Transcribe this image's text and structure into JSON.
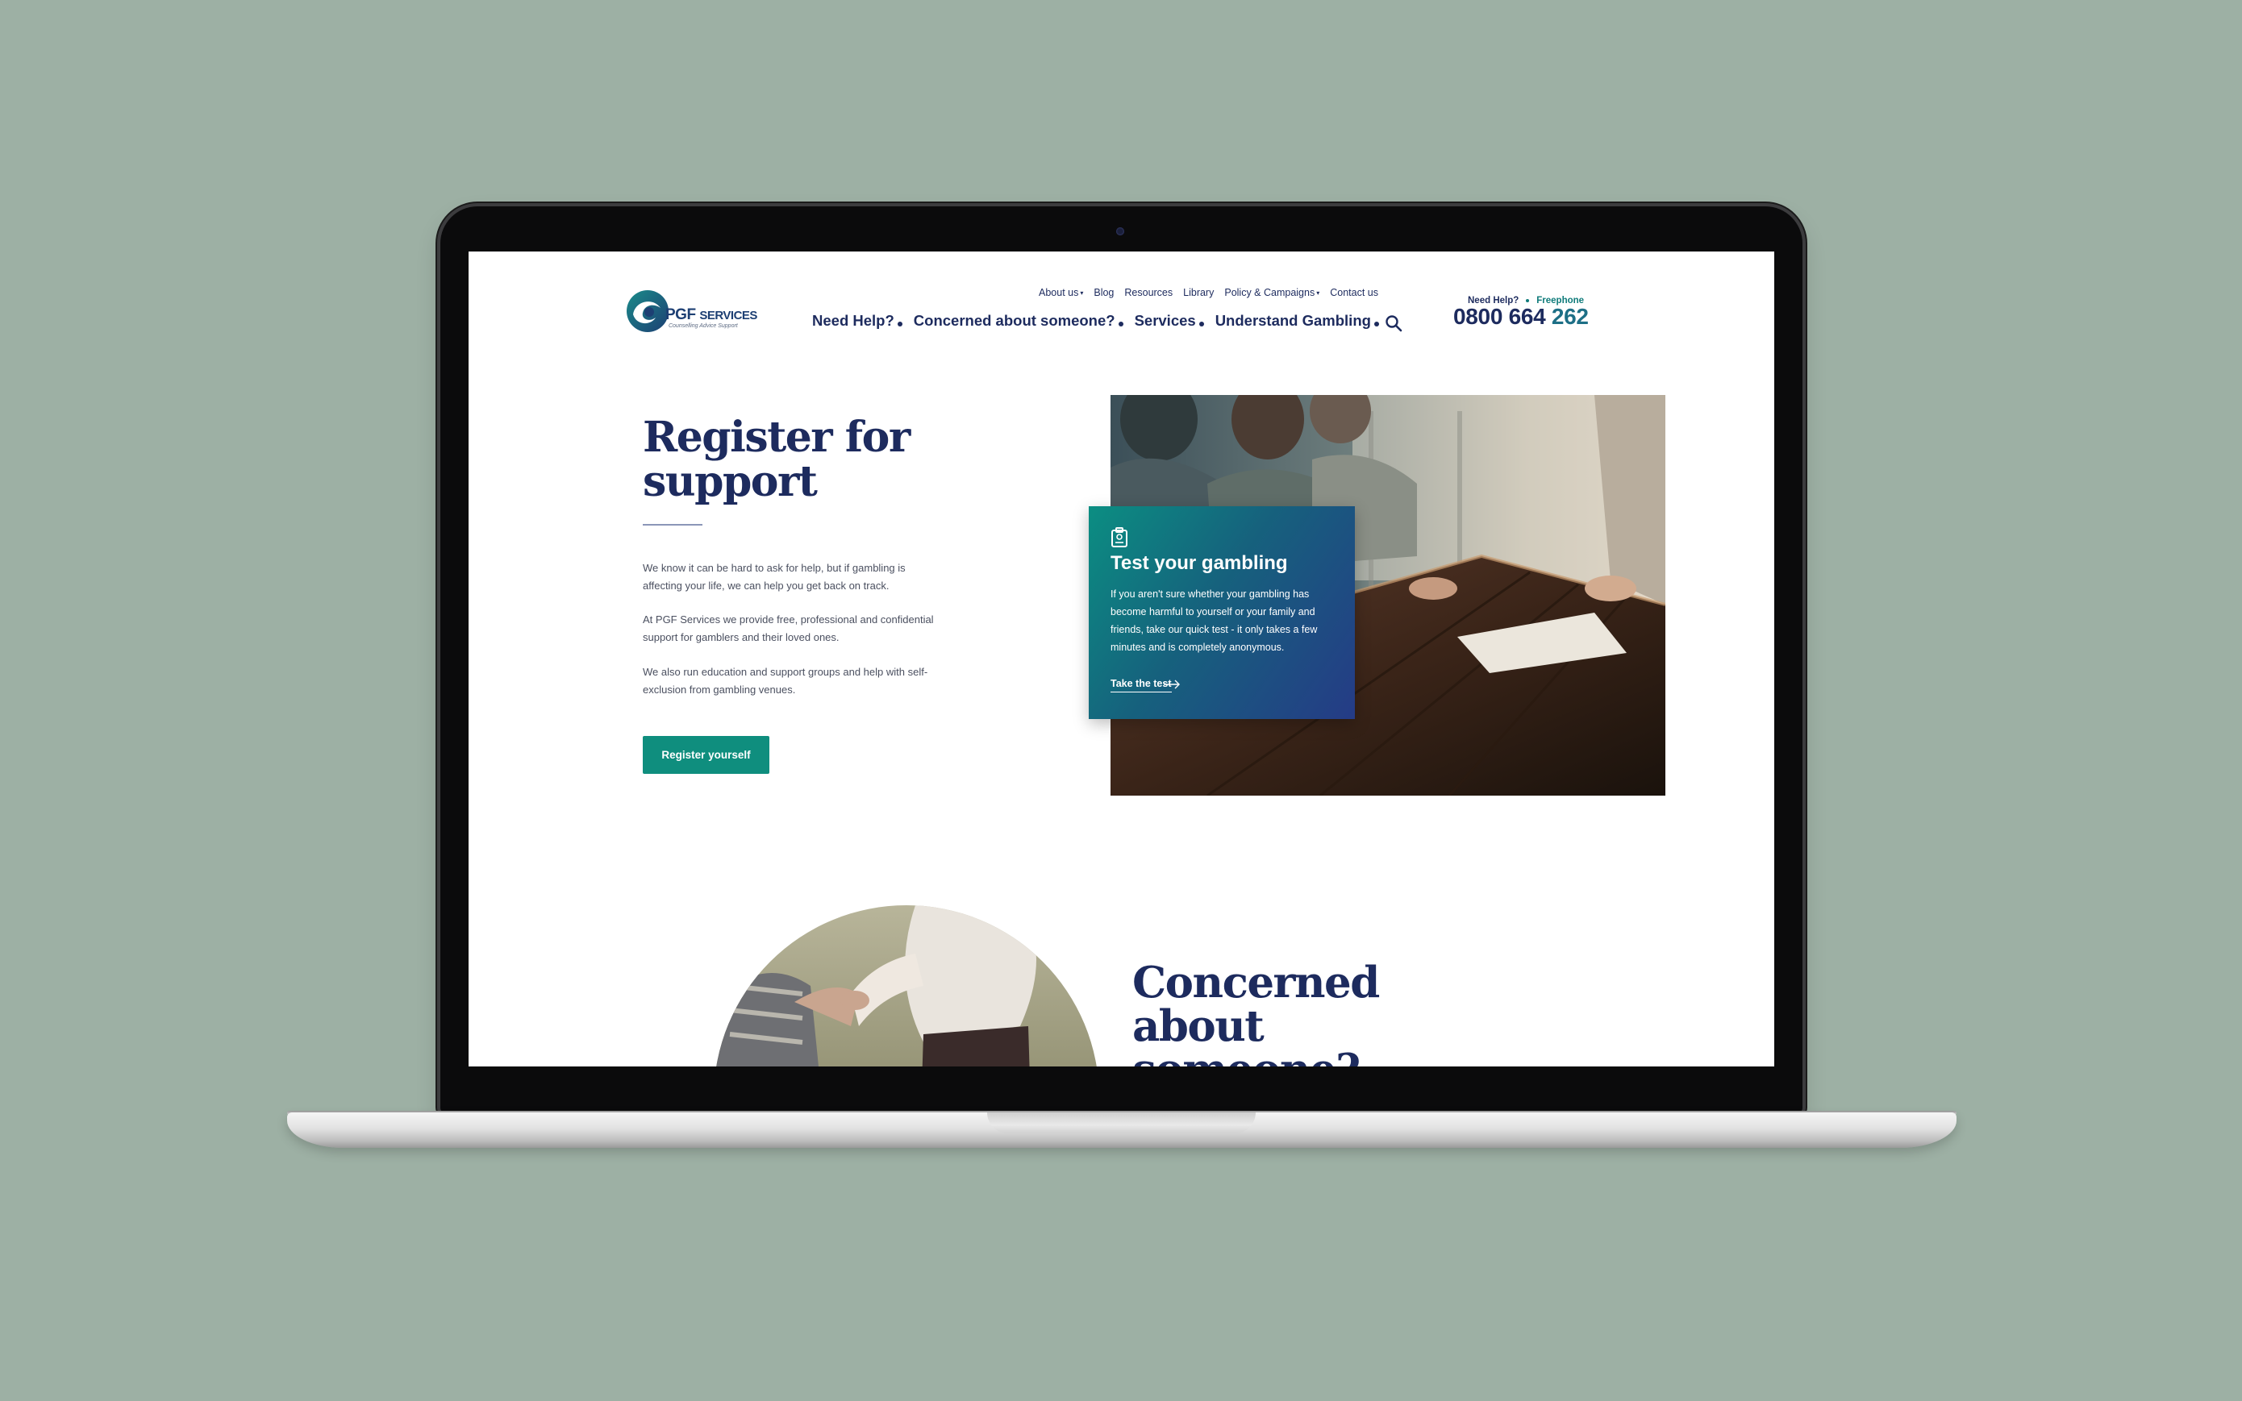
{
  "brand": {
    "name_main": "PGF",
    "name_rest": "SERVICES",
    "tagline": "Counselling Advice Support"
  },
  "top_nav": [
    {
      "label": "About us",
      "has_caret": true
    },
    {
      "label": "Blog",
      "has_caret": false
    },
    {
      "label": "Resources",
      "has_caret": false
    },
    {
      "label": "Library",
      "has_caret": false
    },
    {
      "label": "Policy & Campaigns",
      "has_caret": true
    },
    {
      "label": "Contact us",
      "has_caret": false
    }
  ],
  "main_nav": [
    {
      "label": "Need Help?"
    },
    {
      "label": "Concerned about someone?"
    },
    {
      "label": "Services"
    },
    {
      "label": "Understand Gambling"
    }
  ],
  "helpline": {
    "need_help": "Need Help?",
    "freephone": "Freephone",
    "number_main": "0800 664",
    "number_last": "262"
  },
  "hero": {
    "title": "Register for support",
    "paragraphs": [
      "We know it can be hard to ask for help, but if gambling is affecting your life, we can help you get back on track.",
      "At PGF Services we provide free, professional and confidential support for gamblers and their loved ones.",
      "We also run education and support groups and help with self-exclusion from gambling venues."
    ],
    "button_label": "Register yourself"
  },
  "test_card": {
    "title": "Test your gambling",
    "body": "If you aren't sure whether your gambling has become harmful to yourself or your family and friends, take our quick test - it only takes a few minutes and is completely anonymous.",
    "link_label": "Take the test"
  },
  "concerned": {
    "title": "Concerned about someone?"
  },
  "colors": {
    "background": "#9db0a4",
    "navy": "#1d2b5e",
    "teal_button": "#0f8e7e",
    "card_gradient_start": "#0b8e82",
    "card_gradient_end": "#253b86"
  }
}
